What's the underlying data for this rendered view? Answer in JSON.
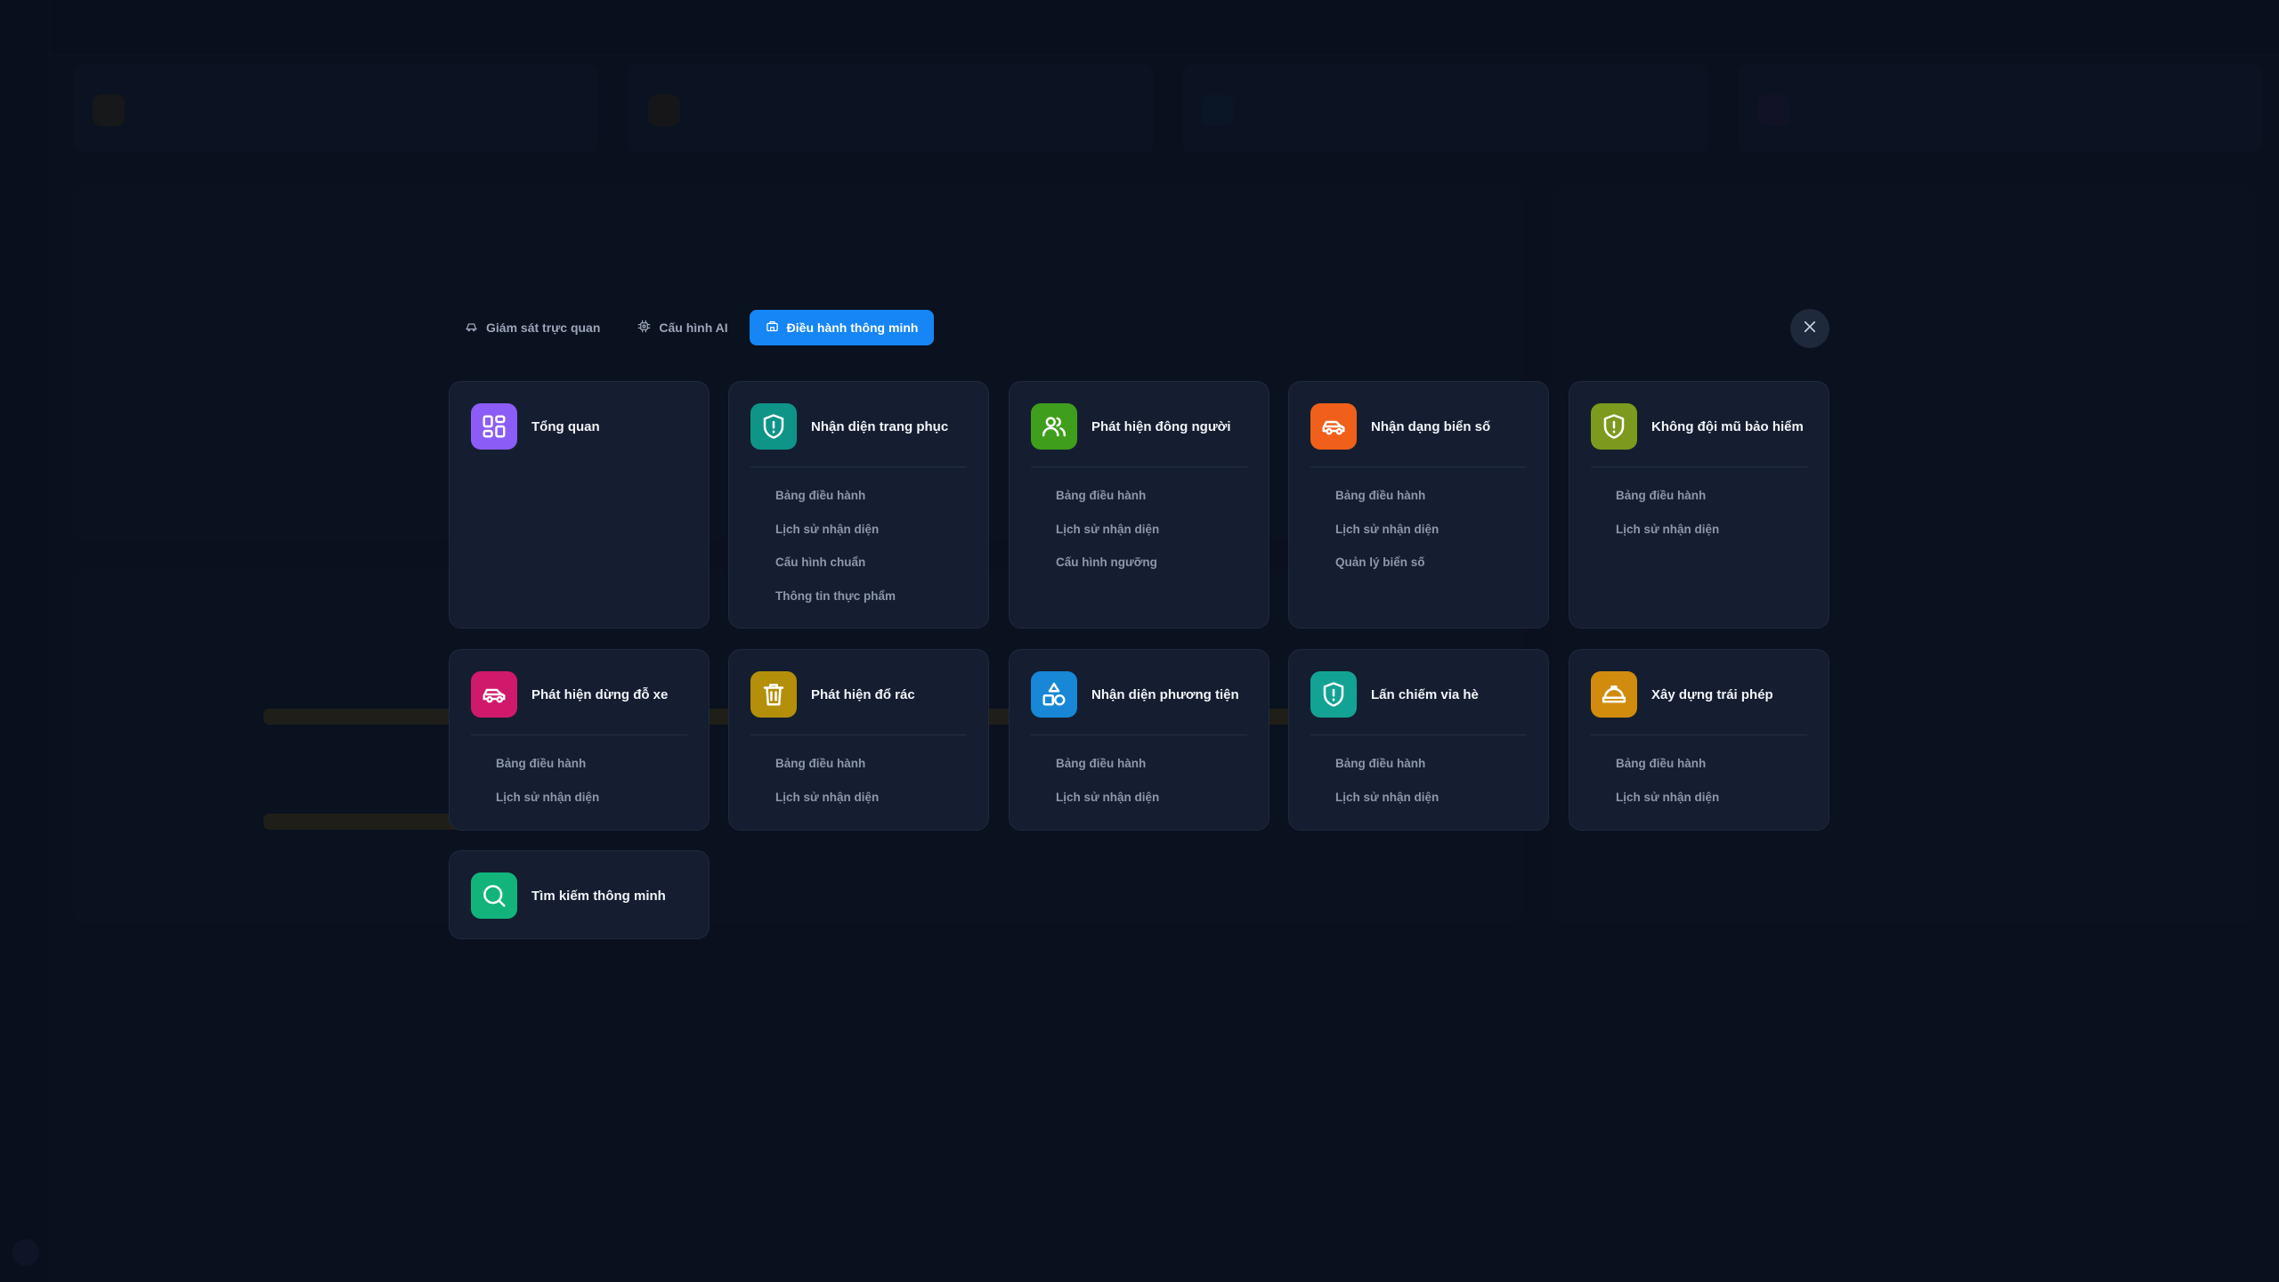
{
  "tabs": [
    {
      "label": "Giám sát trực quan",
      "icon": "car-monitor-icon",
      "active": false
    },
    {
      "label": "Cấu hình AI",
      "icon": "chip-icon",
      "active": false
    },
    {
      "label": "Điều hành thông minh",
      "icon": "building-icon",
      "active": true
    }
  ],
  "close_icon": "close-icon",
  "modules": [
    {
      "title": "Tổng quan",
      "icon": "dashboard-grid-icon",
      "color": "#8b5cf6",
      "items": []
    },
    {
      "title": "Nhận diện trang phục",
      "icon": "shield-alert-icon",
      "color": "#0f9488",
      "items": [
        "Bảng điều hành",
        "Lịch sử nhận diện",
        "Cấu hình chuẩn",
        "Thông tin thực phẩm"
      ]
    },
    {
      "title": "Phát hiện đông người",
      "icon": "users-icon",
      "color": "#3f9e1c",
      "items": [
        "Bảng điều hành",
        "Lịch sử nhận diện",
        "Cấu hình ngưỡng"
      ]
    },
    {
      "title": "Nhận dạng biển số",
      "icon": "car-icon",
      "color": "#f0601a",
      "items": [
        "Bảng điều hành",
        "Lịch sử nhận diện",
        "Quản lý biển số"
      ]
    },
    {
      "title": "Không đội mũ bảo hiểm",
      "icon": "shield-alert-icon",
      "color": "#7c9a1e",
      "items": [
        "Bảng điều hành",
        "Lịch sử nhận diện"
      ]
    },
    {
      "title": "Phát hiện dừng đỗ xe",
      "icon": "car-icon",
      "color": "#d1196b",
      "items": [
        "Bảng điều hành",
        "Lịch sử nhận diện"
      ]
    },
    {
      "title": "Phát hiện đổ rác",
      "icon": "trash-icon",
      "color": "#b38f0a",
      "items": [
        "Bảng điều hành",
        "Lịch sử nhận diện"
      ]
    },
    {
      "title": "Nhận diện phương tiện",
      "icon": "shapes-icon",
      "color": "#1787d6",
      "items": [
        "Bảng điều hành",
        "Lịch sử nhận diện"
      ]
    },
    {
      "title": "Lấn chiếm vỉa hè",
      "icon": "shield-alert-icon",
      "color": "#13a394",
      "items": [
        "Bảng điều hành",
        "Lịch sử nhận diện"
      ]
    },
    {
      "title": "Xây dựng trái phép",
      "icon": "hardhat-icon",
      "color": "#d18c0e",
      "items": [
        "Bảng điều hành",
        "Lịch sử nhận diện"
      ]
    },
    {
      "title": "Tìm kiếm thông minh",
      "icon": "search-icon",
      "color": "#12b47c",
      "items": []
    }
  ]
}
